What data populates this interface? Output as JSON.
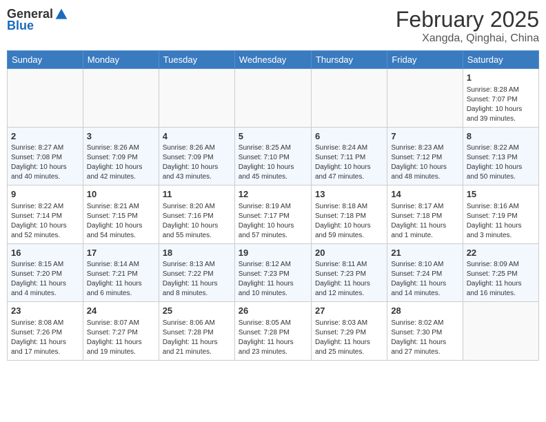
{
  "logo": {
    "general": "General",
    "blue": "Blue"
  },
  "header": {
    "title": "February 2025",
    "subtitle": "Xangda, Qinghai, China"
  },
  "weekdays": [
    "Sunday",
    "Monday",
    "Tuesday",
    "Wednesday",
    "Thursday",
    "Friday",
    "Saturday"
  ],
  "weeks": [
    [
      {
        "day": "",
        "info": ""
      },
      {
        "day": "",
        "info": ""
      },
      {
        "day": "",
        "info": ""
      },
      {
        "day": "",
        "info": ""
      },
      {
        "day": "",
        "info": ""
      },
      {
        "day": "",
        "info": ""
      },
      {
        "day": "1",
        "info": "Sunrise: 8:28 AM\nSunset: 7:07 PM\nDaylight: 10 hours\nand 39 minutes."
      }
    ],
    [
      {
        "day": "2",
        "info": "Sunrise: 8:27 AM\nSunset: 7:08 PM\nDaylight: 10 hours\nand 40 minutes."
      },
      {
        "day": "3",
        "info": "Sunrise: 8:26 AM\nSunset: 7:09 PM\nDaylight: 10 hours\nand 42 minutes."
      },
      {
        "day": "4",
        "info": "Sunrise: 8:26 AM\nSunset: 7:09 PM\nDaylight: 10 hours\nand 43 minutes."
      },
      {
        "day": "5",
        "info": "Sunrise: 8:25 AM\nSunset: 7:10 PM\nDaylight: 10 hours\nand 45 minutes."
      },
      {
        "day": "6",
        "info": "Sunrise: 8:24 AM\nSunset: 7:11 PM\nDaylight: 10 hours\nand 47 minutes."
      },
      {
        "day": "7",
        "info": "Sunrise: 8:23 AM\nSunset: 7:12 PM\nDaylight: 10 hours\nand 48 minutes."
      },
      {
        "day": "8",
        "info": "Sunrise: 8:22 AM\nSunset: 7:13 PM\nDaylight: 10 hours\nand 50 minutes."
      }
    ],
    [
      {
        "day": "9",
        "info": "Sunrise: 8:22 AM\nSunset: 7:14 PM\nDaylight: 10 hours\nand 52 minutes."
      },
      {
        "day": "10",
        "info": "Sunrise: 8:21 AM\nSunset: 7:15 PM\nDaylight: 10 hours\nand 54 minutes."
      },
      {
        "day": "11",
        "info": "Sunrise: 8:20 AM\nSunset: 7:16 PM\nDaylight: 10 hours\nand 55 minutes."
      },
      {
        "day": "12",
        "info": "Sunrise: 8:19 AM\nSunset: 7:17 PM\nDaylight: 10 hours\nand 57 minutes."
      },
      {
        "day": "13",
        "info": "Sunrise: 8:18 AM\nSunset: 7:18 PM\nDaylight: 10 hours\nand 59 minutes."
      },
      {
        "day": "14",
        "info": "Sunrise: 8:17 AM\nSunset: 7:18 PM\nDaylight: 11 hours\nand 1 minute."
      },
      {
        "day": "15",
        "info": "Sunrise: 8:16 AM\nSunset: 7:19 PM\nDaylight: 11 hours\nand 3 minutes."
      }
    ],
    [
      {
        "day": "16",
        "info": "Sunrise: 8:15 AM\nSunset: 7:20 PM\nDaylight: 11 hours\nand 4 minutes."
      },
      {
        "day": "17",
        "info": "Sunrise: 8:14 AM\nSunset: 7:21 PM\nDaylight: 11 hours\nand 6 minutes."
      },
      {
        "day": "18",
        "info": "Sunrise: 8:13 AM\nSunset: 7:22 PM\nDaylight: 11 hours\nand 8 minutes."
      },
      {
        "day": "19",
        "info": "Sunrise: 8:12 AM\nSunset: 7:23 PM\nDaylight: 11 hours\nand 10 minutes."
      },
      {
        "day": "20",
        "info": "Sunrise: 8:11 AM\nSunset: 7:23 PM\nDaylight: 11 hours\nand 12 minutes."
      },
      {
        "day": "21",
        "info": "Sunrise: 8:10 AM\nSunset: 7:24 PM\nDaylight: 11 hours\nand 14 minutes."
      },
      {
        "day": "22",
        "info": "Sunrise: 8:09 AM\nSunset: 7:25 PM\nDaylight: 11 hours\nand 16 minutes."
      }
    ],
    [
      {
        "day": "23",
        "info": "Sunrise: 8:08 AM\nSunset: 7:26 PM\nDaylight: 11 hours\nand 17 minutes."
      },
      {
        "day": "24",
        "info": "Sunrise: 8:07 AM\nSunset: 7:27 PM\nDaylight: 11 hours\nand 19 minutes."
      },
      {
        "day": "25",
        "info": "Sunrise: 8:06 AM\nSunset: 7:28 PM\nDaylight: 11 hours\nand 21 minutes."
      },
      {
        "day": "26",
        "info": "Sunrise: 8:05 AM\nSunset: 7:28 PM\nDaylight: 11 hours\nand 23 minutes."
      },
      {
        "day": "27",
        "info": "Sunrise: 8:03 AM\nSunset: 7:29 PM\nDaylight: 11 hours\nand 25 minutes."
      },
      {
        "day": "28",
        "info": "Sunrise: 8:02 AM\nSunset: 7:30 PM\nDaylight: 11 hours\nand 27 minutes."
      },
      {
        "day": "",
        "info": ""
      }
    ]
  ]
}
